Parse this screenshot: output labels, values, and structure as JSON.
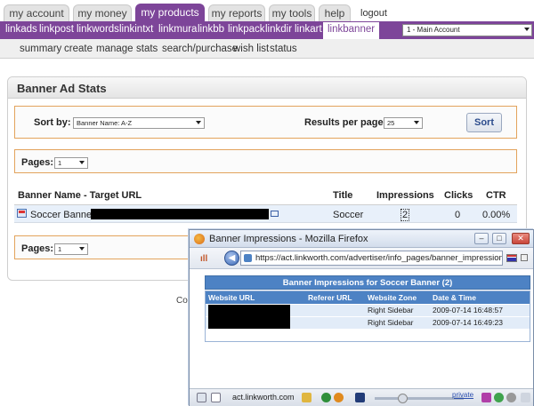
{
  "top_tabs": [
    "my account",
    "my money",
    "my products",
    "my reports",
    "my tools",
    "help",
    "logout"
  ],
  "active_top_tab": "my products",
  "sub_nav": [
    "linkads",
    "linkpost",
    "linkwords",
    "linkintxt",
    "linkmura",
    "linkbb",
    "linkpack",
    "linkdir",
    "linkart",
    "linkbanner"
  ],
  "active_sub_nav": "linkbanner",
  "account_select": "1 - Main Account",
  "third_nav": [
    "summary",
    "create",
    "manage",
    "stats",
    "search/purchase",
    "wish list",
    "status"
  ],
  "panel_title": "Banner Ad Stats",
  "controls": {
    "sort_by_label": "Sort by:",
    "sort_by_value": "Banner Name: A-Z",
    "results_label": "Results per page:",
    "results_value": "25",
    "sort_button": "Sort",
    "pages_label": "Pages:",
    "pages_value": "1"
  },
  "table": {
    "headers": [
      "Banner Name - Target URL",
      "Title",
      "Impressions",
      "Clicks",
      "CTR"
    ],
    "rows": [
      {
        "banner_name": "Soccer Banner -",
        "title": "Soccer",
        "impressions": "2",
        "clicks": "0",
        "ctr": "0.00%"
      }
    ]
  },
  "footer_text": "Cop",
  "popup": {
    "window_title": "Banner Impressions - Mozilla Firefox",
    "url": "https://act.linkworth.com/advertiser/info_pages/banner_impressions.php?",
    "header": "Banner Impressions for Soccer Banner (2)",
    "columns": [
      "Website URL",
      "Referer URL",
      "Website Zone",
      "Date & Time"
    ],
    "rows": [
      {
        "zone": "Right Sidebar",
        "datetime": "2009-07-14 16:48:57"
      },
      {
        "zone": "Right Sidebar",
        "datetime": "2009-07-14 16:49:23"
      }
    ],
    "status_host": "act.linkworth.com",
    "status_private": "private"
  },
  "colors": {
    "brand_purple": "#7d4599",
    "box_orange": "#e3a35c",
    "popup_blue": "#4d82c4",
    "row_blue": "#e8f0fa"
  }
}
